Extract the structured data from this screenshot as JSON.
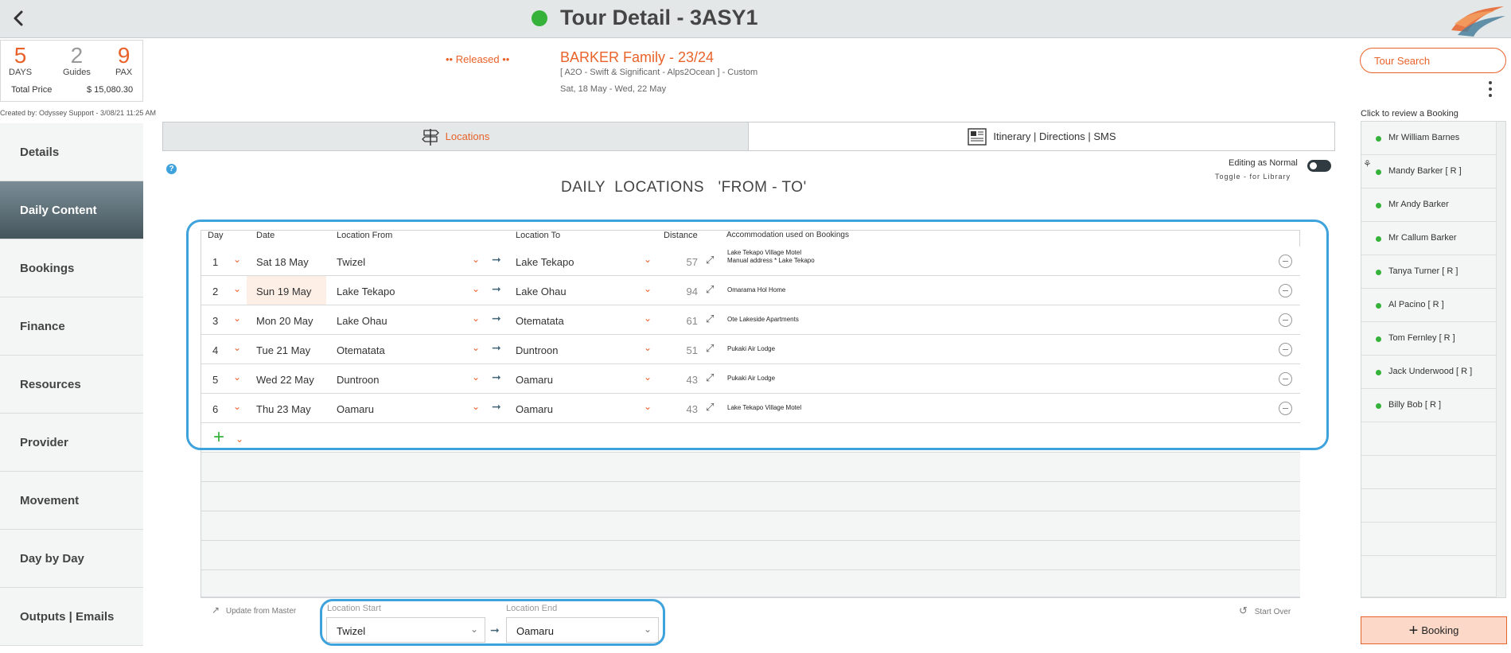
{
  "header": {
    "title": "Tour Detail - 3ASY1",
    "status_color": "#36b23b"
  },
  "summary": {
    "days": "5",
    "days_label": "DAYS",
    "guides": "2",
    "guides_label": "Guides",
    "pax": "9",
    "pax_label": "PAX",
    "total_label": "Total Price",
    "total_value": "$ 15,080.30",
    "created": "Created by: Odyssey Support - 3/08/21 11:25 AM"
  },
  "tour": {
    "status": "•• Released ••",
    "family": "BARKER Family - 23/24",
    "product": "[ A2O - Swift & Significant - Alps2Ocean ] - Custom",
    "dates": "Sat, 18 May  - Wed, 22 May"
  },
  "nav": [
    "Details",
    "Daily Content",
    "Bookings",
    "Finance",
    "Resources",
    "Provider",
    "Movement",
    "Day by Day",
    "Outputs | Emails"
  ],
  "nav_active": "Daily Content",
  "tabs": {
    "locations": "Locations",
    "itinerary": "Itinerary | Directions | SMS"
  },
  "editing": {
    "label": "Editing as Normal",
    "hint": "Toggle - for Library"
  },
  "section_title": "DAILY  LOCATIONS   'FROM - TO'",
  "table": {
    "headers": {
      "day": "Day",
      "date": "Date",
      "from": "Location From",
      "to": "Location To",
      "distance": "Distance",
      "accommodation": "Accommodation used on Bookings"
    },
    "rows": [
      {
        "day": "1",
        "date": "Sat 18 May",
        "from": "Twizel",
        "to": "Lake Tekapo",
        "distance": "57",
        "acc1": "Lake Tekapo Village Motel",
        "acc2": "Manual address * Lake Tekapo"
      },
      {
        "day": "2",
        "date": "Sun 19 May",
        "from": "Lake Tekapo",
        "to": "Lake Ohau",
        "distance": "94",
        "acc1": "Omarama Hol Home",
        "acc2": ""
      },
      {
        "day": "3",
        "date": "Mon 20 May",
        "from": "Lake Ohau",
        "to": "Otematata",
        "distance": "61",
        "acc1": "Ote Lakeside Apartments",
        "acc2": ""
      },
      {
        "day": "4",
        "date": "Tue 21 May",
        "from": "Otematata",
        "to": "Duntroon",
        "distance": "51",
        "acc1": "Pukaki Air Lodge",
        "acc2": ""
      },
      {
        "day": "5",
        "date": "Wed 22 May",
        "from": "Duntroon",
        "to": "Oamaru",
        "distance": "43",
        "acc1": "Pukaki Air Lodge",
        "acc2": ""
      },
      {
        "day": "6",
        "date": "Thu 23 May",
        "from": "Oamaru",
        "to": "Oamaru",
        "distance": "43",
        "acc1": "Lake Tekapo Village Motel",
        "acc2": ""
      }
    ]
  },
  "bottom": {
    "update_master": "Update from Master",
    "start_label": "Location Start",
    "start_value": "Twizel",
    "end_label": "Location End",
    "end_value": "Oamaru",
    "start_over": "Start Over"
  },
  "right": {
    "tour_search": "Tour Search",
    "booking_hint": "Click to review a Booking",
    "bookings": [
      "Mr William Barnes",
      "Mandy Barker  [ R ]",
      "Mr Andy Barker",
      "Mr Callum Barker",
      "Tanya Turner  [ R ]",
      "Al Pacino  [ R ]",
      "Tom Fernley  [ R ]",
      "Jack Underwood  [ R ]",
      "Billy Bob  [ R ]"
    ],
    "add_booking": "Booking"
  },
  "colors": {
    "accent": "#e8622a",
    "highlight": "#3ea2dc",
    "status_green": "#36b23b"
  }
}
